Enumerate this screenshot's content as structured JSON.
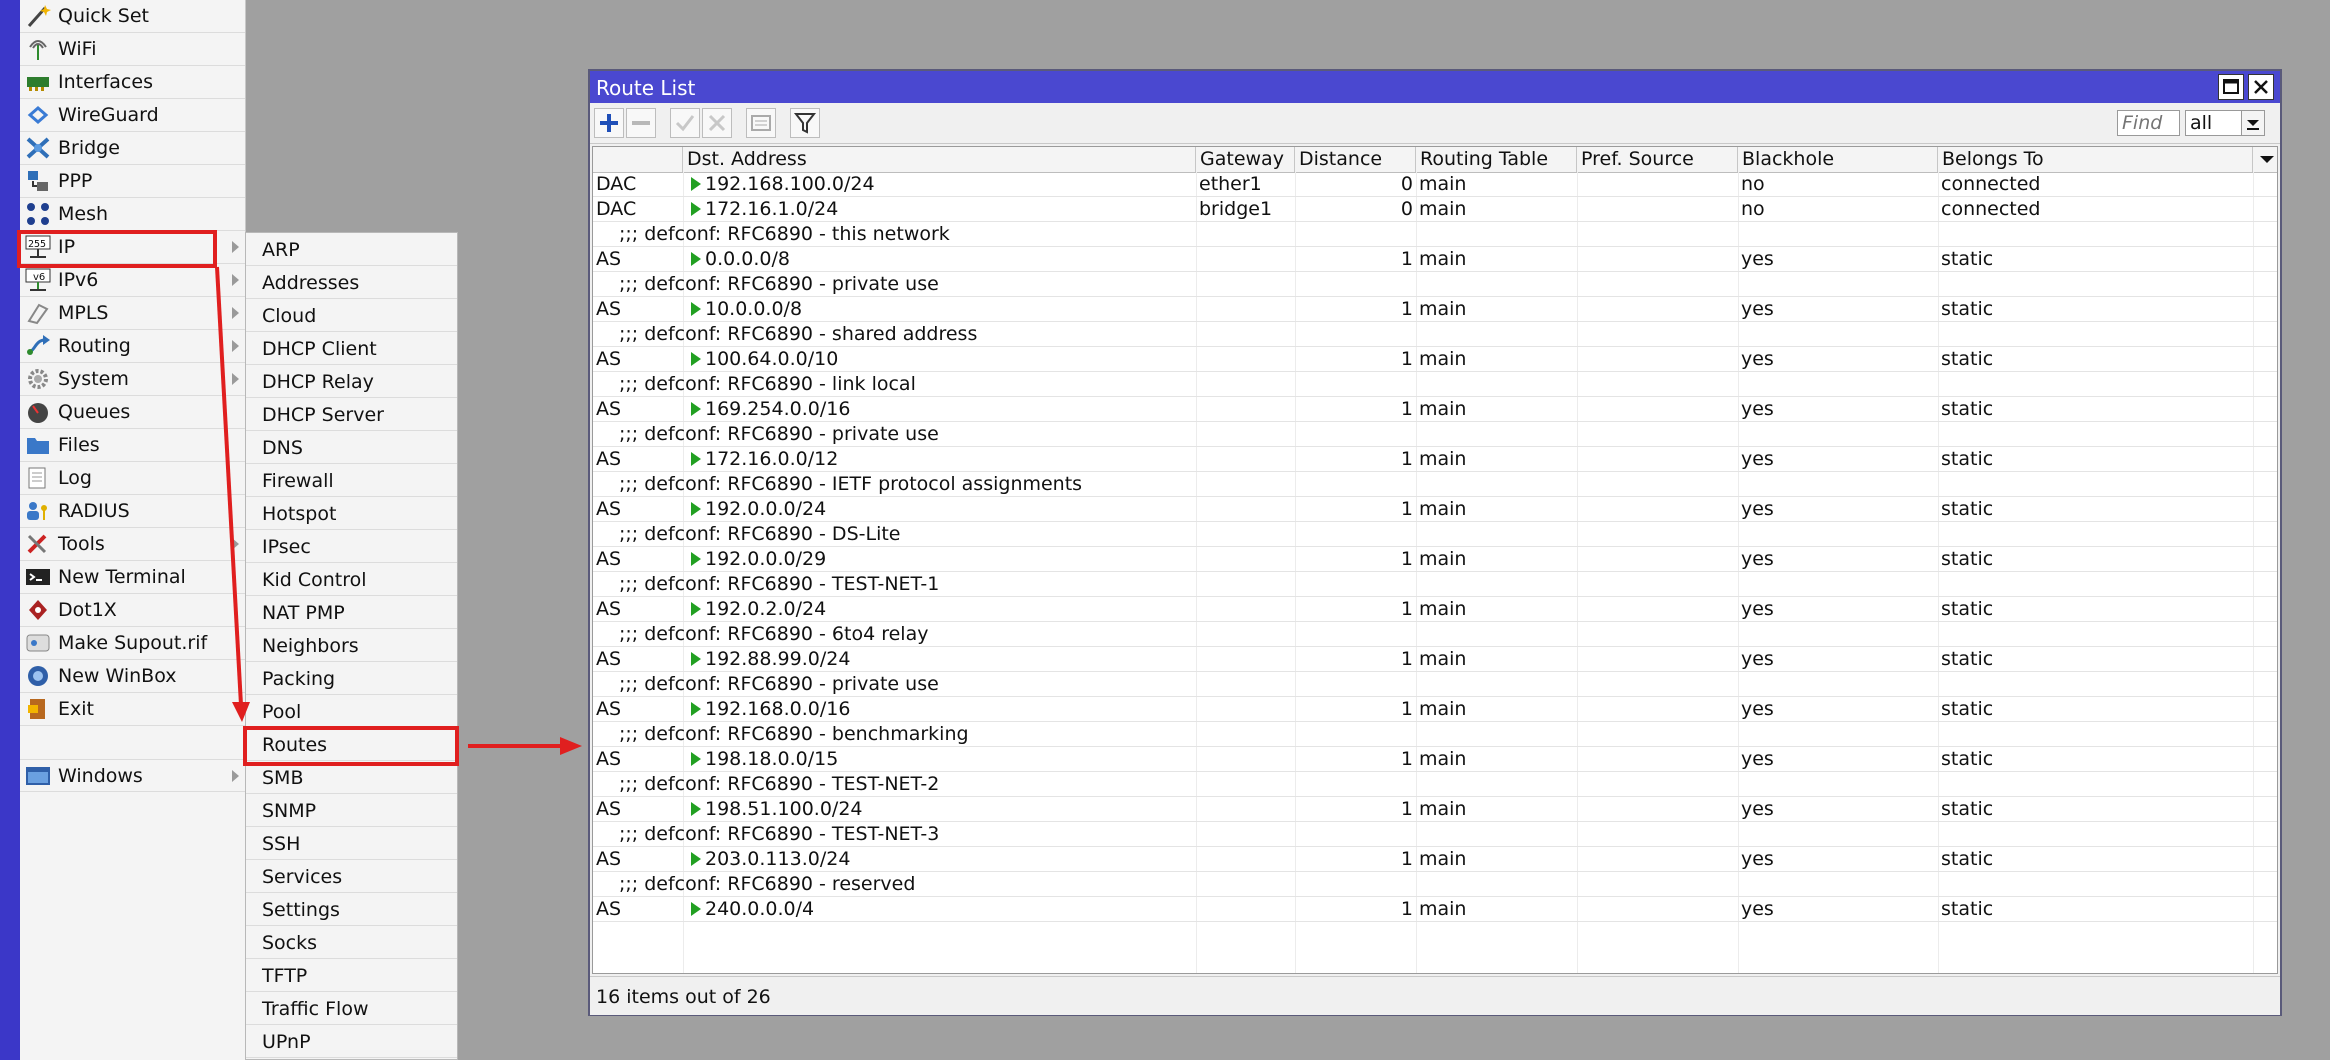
{
  "main_menu": {
    "items": [
      {
        "label": "Quick Set",
        "icon": "wand-icon",
        "submenu": false
      },
      {
        "label": "WiFi",
        "icon": "wifi-antenna-icon",
        "submenu": false
      },
      {
        "label": "Interfaces",
        "icon": "network-card-icon",
        "submenu": false
      },
      {
        "label": "WireGuard",
        "icon": "wireguard-icon",
        "submenu": false
      },
      {
        "label": "Bridge",
        "icon": "bridge-icon",
        "submenu": false
      },
      {
        "label": "PPP",
        "icon": "ppp-icon",
        "submenu": false
      },
      {
        "label": "Mesh",
        "icon": "mesh-icon",
        "submenu": false
      },
      {
        "label": "IP",
        "icon": "ip-255-icon",
        "submenu": true
      },
      {
        "label": "IPv6",
        "icon": "ipv6-icon",
        "submenu": true
      },
      {
        "label": "MPLS",
        "icon": "mpls-icon",
        "submenu": true
      },
      {
        "label": "Routing",
        "icon": "routing-icon",
        "submenu": true
      },
      {
        "label": "System",
        "icon": "gear-icon",
        "submenu": true
      },
      {
        "label": "Queues",
        "icon": "gauge-icon",
        "submenu": false
      },
      {
        "label": "Files",
        "icon": "folder-icon",
        "submenu": false
      },
      {
        "label": "Log",
        "icon": "log-icon",
        "submenu": false
      },
      {
        "label": "RADIUS",
        "icon": "radius-users-icon",
        "submenu": false
      },
      {
        "label": "Tools",
        "icon": "tools-icon",
        "submenu": true
      },
      {
        "label": "New Terminal",
        "icon": "terminal-icon",
        "submenu": false
      },
      {
        "label": "Dot1X",
        "icon": "dot1x-icon",
        "submenu": false
      },
      {
        "label": "Make Supout.rif",
        "icon": "supout-icon",
        "submenu": false
      },
      {
        "label": "New WinBox",
        "icon": "winbox-icon",
        "submenu": false
      },
      {
        "label": "Exit",
        "icon": "exit-door-icon",
        "submenu": false
      },
      {
        "label": "Windows",
        "icon": "window-icon",
        "submenu": true
      }
    ]
  },
  "ip_submenu": {
    "items": [
      "ARP",
      "Addresses",
      "Cloud",
      "DHCP Client",
      "DHCP Relay",
      "DHCP Server",
      "DNS",
      "Firewall",
      "Hotspot",
      "IPsec",
      "Kid Control",
      "NAT PMP",
      "Neighbors",
      "Packing",
      "Pool",
      "Routes",
      "SMB",
      "SNMP",
      "SSH",
      "Services",
      "Settings",
      "Socks",
      "TFTP",
      "Traffic Flow",
      "UPnP"
    ]
  },
  "window": {
    "title": "Route List",
    "toolbar": {
      "icons": [
        "add-icon",
        "remove-icon",
        "enable-icon",
        "disable-icon",
        "comment-icon",
        "filter-icon"
      ],
      "find_placeholder": "Find",
      "filter_value": "all"
    },
    "columns": [
      "",
      "Dst. Address",
      "Gateway",
      "Distance",
      "Routing Table",
      "Pref. Source",
      "Blackhole",
      "Belongs To"
    ],
    "rows": [
      {
        "kind": "route",
        "flags": "DAC",
        "dst": "192.168.100.0/24",
        "gateway": "ether1",
        "distance": "0",
        "table": "main",
        "pref": "",
        "blackhole": "no",
        "belongs": "connected"
      },
      {
        "kind": "route",
        "flags": "DAC",
        "dst": "172.16.1.0/24",
        "gateway": "bridge1",
        "distance": "0",
        "table": "main",
        "pref": "",
        "blackhole": "no",
        "belongs": "connected"
      },
      {
        "kind": "comment",
        "text": ";;; defconf: RFC6890 - this network"
      },
      {
        "kind": "route",
        "flags": "AS",
        "dst": "0.0.0.0/8",
        "gateway": "",
        "distance": "1",
        "table": "main",
        "pref": "",
        "blackhole": "yes",
        "belongs": "static"
      },
      {
        "kind": "comment",
        "text": ";;; defconf: RFC6890 - private use"
      },
      {
        "kind": "route",
        "flags": "AS",
        "dst": "10.0.0.0/8",
        "gateway": "",
        "distance": "1",
        "table": "main",
        "pref": "",
        "blackhole": "yes",
        "belongs": "static"
      },
      {
        "kind": "comment",
        "text": ";;; defconf: RFC6890 - shared address"
      },
      {
        "kind": "route",
        "flags": "AS",
        "dst": "100.64.0.0/10",
        "gateway": "",
        "distance": "1",
        "table": "main",
        "pref": "",
        "blackhole": "yes",
        "belongs": "static"
      },
      {
        "kind": "comment",
        "text": ";;; defconf: RFC6890 - link local"
      },
      {
        "kind": "route",
        "flags": "AS",
        "dst": "169.254.0.0/16",
        "gateway": "",
        "distance": "1",
        "table": "main",
        "pref": "",
        "blackhole": "yes",
        "belongs": "static"
      },
      {
        "kind": "comment",
        "text": ";;; defconf: RFC6890 - private use"
      },
      {
        "kind": "route",
        "flags": "AS",
        "dst": "172.16.0.0/12",
        "gateway": "",
        "distance": "1",
        "table": "main",
        "pref": "",
        "blackhole": "yes",
        "belongs": "static"
      },
      {
        "kind": "comment",
        "text": ";;; defconf: RFC6890 - IETF protocol assignments"
      },
      {
        "kind": "route",
        "flags": "AS",
        "dst": "192.0.0.0/24",
        "gateway": "",
        "distance": "1",
        "table": "main",
        "pref": "",
        "blackhole": "yes",
        "belongs": "static"
      },
      {
        "kind": "comment",
        "text": ";;; defconf: RFC6890 - DS-Lite"
      },
      {
        "kind": "route",
        "flags": "AS",
        "dst": "192.0.0.0/29",
        "gateway": "",
        "distance": "1",
        "table": "main",
        "pref": "",
        "blackhole": "yes",
        "belongs": "static"
      },
      {
        "kind": "comment",
        "text": ";;; defconf: RFC6890 - TEST-NET-1"
      },
      {
        "kind": "route",
        "flags": "AS",
        "dst": "192.0.2.0/24",
        "gateway": "",
        "distance": "1",
        "table": "main",
        "pref": "",
        "blackhole": "yes",
        "belongs": "static"
      },
      {
        "kind": "comment",
        "text": ";;; defconf: RFC6890 - 6to4 relay"
      },
      {
        "kind": "route",
        "flags": "AS",
        "dst": "192.88.99.0/24",
        "gateway": "",
        "distance": "1",
        "table": "main",
        "pref": "",
        "blackhole": "yes",
        "belongs": "static"
      },
      {
        "kind": "comment",
        "text": ";;; defconf: RFC6890 - private use"
      },
      {
        "kind": "route",
        "flags": "AS",
        "dst": "192.168.0.0/16",
        "gateway": "",
        "distance": "1",
        "table": "main",
        "pref": "",
        "blackhole": "yes",
        "belongs": "static"
      },
      {
        "kind": "comment",
        "text": ";;; defconf: RFC6890 - benchmarking"
      },
      {
        "kind": "route",
        "flags": "AS",
        "dst": "198.18.0.0/15",
        "gateway": "",
        "distance": "1",
        "table": "main",
        "pref": "",
        "blackhole": "yes",
        "belongs": "static"
      },
      {
        "kind": "comment",
        "text": ";;; defconf: RFC6890 - TEST-NET-2"
      },
      {
        "kind": "route",
        "flags": "AS",
        "dst": "198.51.100.0/24",
        "gateway": "",
        "distance": "1",
        "table": "main",
        "pref": "",
        "blackhole": "yes",
        "belongs": "static"
      },
      {
        "kind": "comment",
        "text": ";;; defconf: RFC6890 - TEST-NET-3"
      },
      {
        "kind": "route",
        "flags": "AS",
        "dst": "203.0.113.0/24",
        "gateway": "",
        "distance": "1",
        "table": "main",
        "pref": "",
        "blackhole": "yes",
        "belongs": "static"
      },
      {
        "kind": "comment",
        "text": ";;; defconf: RFC6890 - reserved"
      },
      {
        "kind": "route",
        "flags": "AS",
        "dst": "240.0.0.0/4",
        "gateway": "",
        "distance": "1",
        "table": "main",
        "pref": "",
        "blackhole": "yes",
        "belongs": "static"
      }
    ],
    "status": "16 items out of 26"
  },
  "colors": {
    "highlight": "#e01f1f",
    "title_bar": "#4a48d0",
    "side_stripe": "#3b37c8",
    "route_arrow": "#22a022"
  }
}
